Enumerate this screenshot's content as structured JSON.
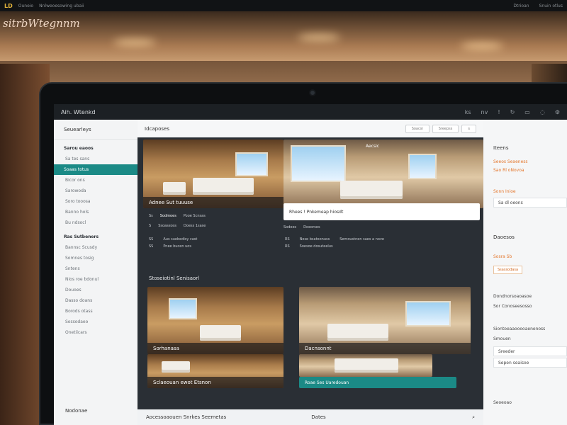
{
  "browser": {
    "left_label": "Ouneio",
    "left_label2": "Nnlweoesowing ubaii",
    "right1": "Dtrioan",
    "right2": "Snuin otlus"
  },
  "brand": "sitrbWtegnnm",
  "app": {
    "title": "Aih. Wtenkd",
    "icons": [
      "ks",
      "nv",
      "c",
      "tb",
      "dn",
      "cs",
      "ts"
    ]
  },
  "left": {
    "header": "Seuearleys",
    "items": [
      {
        "label": "Sarou eaoos",
        "kind": "sect"
      },
      {
        "label": "Sa tes sans",
        "kind": "sub"
      },
      {
        "label": "Soaas totus",
        "kind": "active"
      },
      {
        "label": "Bicor ons",
        "kind": "sub"
      },
      {
        "label": "Sarowoda",
        "kind": "sub"
      },
      {
        "label": "Soro tooosa",
        "kind": "sub"
      },
      {
        "label": "Banno hols",
        "kind": "sub"
      },
      {
        "label": "Bu ndsocl",
        "kind": "sub"
      },
      {
        "label": "Ras Sutbeners",
        "kind": "sect"
      },
      {
        "label": "Bannsc Scusdy",
        "kind": "sub"
      },
      {
        "label": "Somnes tosig",
        "kind": "sub"
      },
      {
        "label": "Sntens",
        "kind": "sub"
      },
      {
        "label": "Nios roe bdonul",
        "kind": "sub"
      },
      {
        "label": "Douoes",
        "kind": "sub"
      },
      {
        "label": "Dasso doans",
        "kind": "sub"
      },
      {
        "label": "Borods otass",
        "kind": "sub"
      },
      {
        "label": "Sossodaeo",
        "kind": "sub"
      },
      {
        "label": "Onetiicars",
        "kind": "sub"
      }
    ],
    "footer": "Nodonae"
  },
  "main": {
    "header": "Idcaposes",
    "pills": [
      "Soacsi",
      "Sreepss",
      "s"
    ],
    "card1_caption": "Adnee Sut tuuuse",
    "card2_overlay": "Rhees ! Pnkemeap hiosdt",
    "card2_caption": "Aecsic",
    "meta1": [
      {
        "k": "Ss",
        "v": "Sodmoes"
      },
      {
        "k": "",
        "v": "Pooe Scnsas"
      }
    ],
    "meta2": [
      {
        "k": "Sodees",
        "v": "Doeorses"
      }
    ],
    "meta3": [
      {
        "k": "SS",
        "v": "Aus suebedisy cast"
      },
      {
        "k": "SS",
        "v": "Pnee bucen uos"
      }
    ],
    "meta4": [
      {
        "k": "RS",
        "v": "Nose bsatoonuss"
      },
      {
        "k": "",
        "v": "Semoustnen saes a nove"
      },
      {
        "k": "RS",
        "v": "Soesoe dosuteelus"
      }
    ],
    "section": "Stoseiotinl Senisaorl",
    "card3_caption": "Sorhanasa",
    "card4_caption": "Dacnsonnt",
    "card5_caption": "Sclaeouan ewot Etsnon",
    "card6_caption": "Roae Ses Uaredouan",
    "bottom_left": "Aocessoaouen Snrkes Seemetas",
    "bottom_left2": "Soeuss Ie Esseneo",
    "bottom_mid": "Dates",
    "bottom_mid2": "Dao nuaneitoio"
  },
  "right": {
    "title": "Iteens",
    "o1": "Seeos Seaeness",
    "o2": "Sao Rl oNovoa",
    "o3": "Sonn Inioe",
    "box1": "Sa dl oeons",
    "title2": "Daoesos",
    "o4": "Sosra Sb",
    "chip": "Ssassodasa",
    "l1": "Dondnorsoaoasoe",
    "l2": "Sor Conoseesosso",
    "l3": "Siontoeaaooooaenenoss",
    "l4": "Smouen",
    "box2": "Sreeder",
    "box3": "Sepen seaisoe",
    "foot": "Seoeoao"
  },
  "colors": {
    "accent": "#1b8a86",
    "highlight": "#e4762b"
  }
}
